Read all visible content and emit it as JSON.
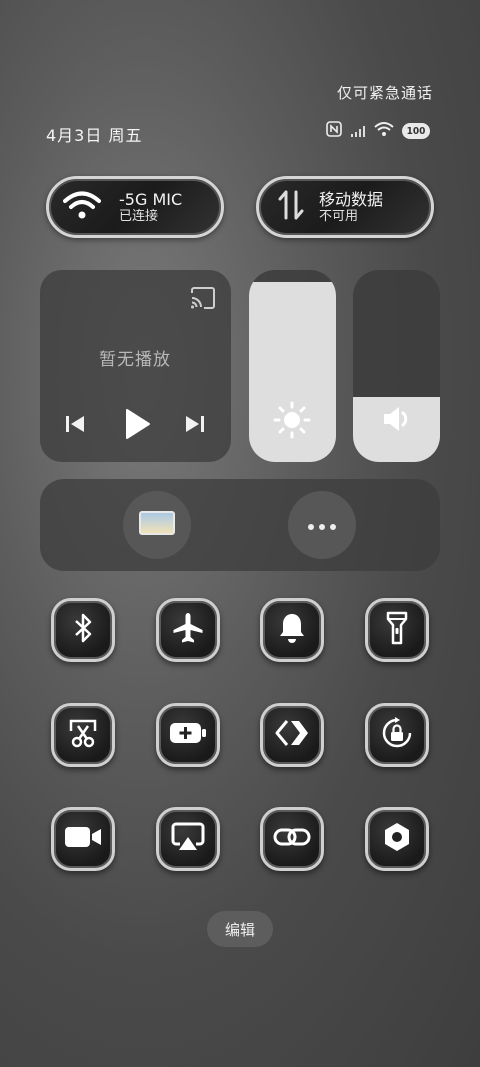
{
  "status": {
    "emergency_text": "仅可紧急通话",
    "date_text": "4月3日 周五",
    "battery_level": "100"
  },
  "wifi_pill": {
    "title": "-5G    MIC",
    "subtitle": "已连接"
  },
  "data_pill": {
    "title": "移动数据",
    "subtitle": "不可用"
  },
  "media": {
    "status_text": "暂无播放"
  },
  "sliders": {
    "brightness_level": 0.94,
    "volume_level": 0.34
  },
  "tiles": [
    {
      "name": "bluetooth",
      "icon": "bluetooth-icon"
    },
    {
      "name": "airplane-mode",
      "icon": "airplane-icon"
    },
    {
      "name": "ring-mode",
      "icon": "bell-icon"
    },
    {
      "name": "flashlight",
      "icon": "flashlight-icon"
    },
    {
      "name": "screenshot",
      "icon": "scissors-icon"
    },
    {
      "name": "battery-saver",
      "icon": "battery-plus-icon"
    },
    {
      "name": "transfer",
      "icon": "arrows-icon"
    },
    {
      "name": "rotation-lock",
      "icon": "rotate-lock-icon"
    },
    {
      "name": "screen-record",
      "icon": "video-camera-icon"
    },
    {
      "name": "screen-cast",
      "icon": "cast-icon"
    },
    {
      "name": "link",
      "icon": "link-icon"
    },
    {
      "name": "settings",
      "icon": "hexagon-icon"
    }
  ],
  "edit_label": "编辑"
}
